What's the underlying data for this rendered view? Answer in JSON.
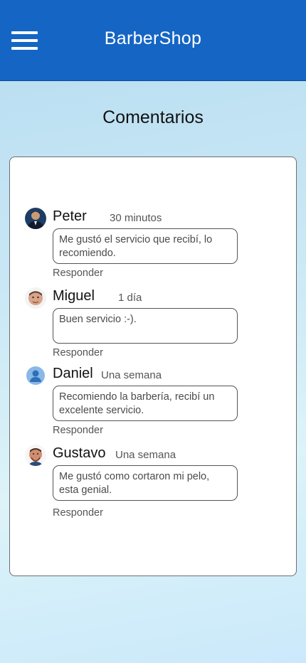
{
  "header": {
    "title": "BarberShop",
    "menu_icon": "hamburger-menu-icon"
  },
  "page": {
    "title": "Comentarios"
  },
  "comments": [
    {
      "name": "Peter",
      "time": "30 minutos",
      "text": "Me gustó el servicio que recibí, lo recomiendo.",
      "reply": "Responder",
      "avatar": "person-photo-avatar"
    },
    {
      "name": "Miguel",
      "time": "1 día",
      "text": "Buen servicio :-).",
      "reply": "Responder",
      "avatar": "person-photo-avatar"
    },
    {
      "name": "Daniel",
      "time": "Una semana",
      "text": "Recomiendo la barbería, recibí un excelente servicio.",
      "reply": "Responder",
      "avatar": "default-user-avatar"
    },
    {
      "name": "Gustavo",
      "time": "Una semana",
      "text": "Me gustó como cortaron mi pelo, esta genial.",
      "reply": "Responder",
      "avatar": "person-photo-avatar"
    }
  ],
  "colors": {
    "appbar": "#1565c4",
    "card": "#ffffff"
  }
}
